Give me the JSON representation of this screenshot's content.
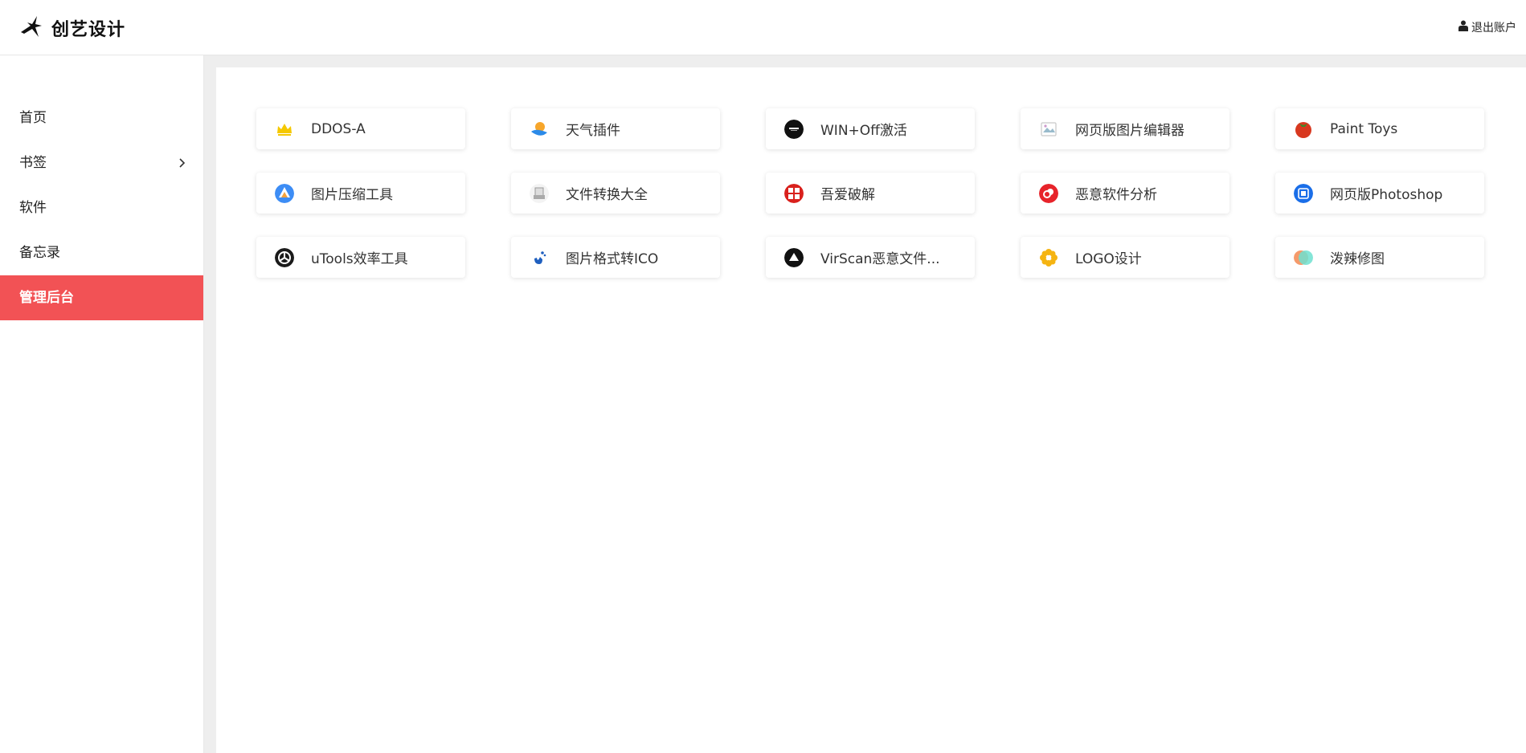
{
  "header": {
    "brand_title": "创艺设计",
    "logout_label": "退出账户"
  },
  "sidebar": {
    "items": [
      {
        "label": "首页",
        "has_submenu": false
      },
      {
        "label": "书签",
        "has_submenu": true
      },
      {
        "label": "软件",
        "has_submenu": false
      },
      {
        "label": "备忘录",
        "has_submenu": false
      },
      {
        "label": "管理后台",
        "has_submenu": false,
        "active": true
      }
    ],
    "active_color": "#f25255"
  },
  "cards": [
    {
      "label": "DDOS-A",
      "icon": "crown-icon"
    },
    {
      "label": "天气插件",
      "icon": "weather-icon"
    },
    {
      "label": "WIN+Off激活",
      "icon": "win-office-icon"
    },
    {
      "label": "网页版图片编辑器",
      "icon": "broken-image-icon"
    },
    {
      "label": "Paint Toys",
      "icon": "tomato-icon"
    },
    {
      "label": "图片压缩工具",
      "icon": "compress-icon"
    },
    {
      "label": "文件转换大全",
      "icon": "file-convert-icon"
    },
    {
      "label": "吾爱破解",
      "icon": "52pojie-icon"
    },
    {
      "label": "恶意软件分析",
      "icon": "malware-analysis-icon"
    },
    {
      "label": "网页版Photoshop",
      "icon": "photoshop-web-icon"
    },
    {
      "label": "uTools效率工具",
      "icon": "utools-icon"
    },
    {
      "label": "图片格式转ICO",
      "icon": "ico-convert-icon"
    },
    {
      "label": "VirScan恶意文件...",
      "icon": "virscan-icon"
    },
    {
      "label": "LOGO设计",
      "icon": "flower-icon"
    },
    {
      "label": "泼辣修图",
      "icon": "polarr-icon"
    }
  ]
}
